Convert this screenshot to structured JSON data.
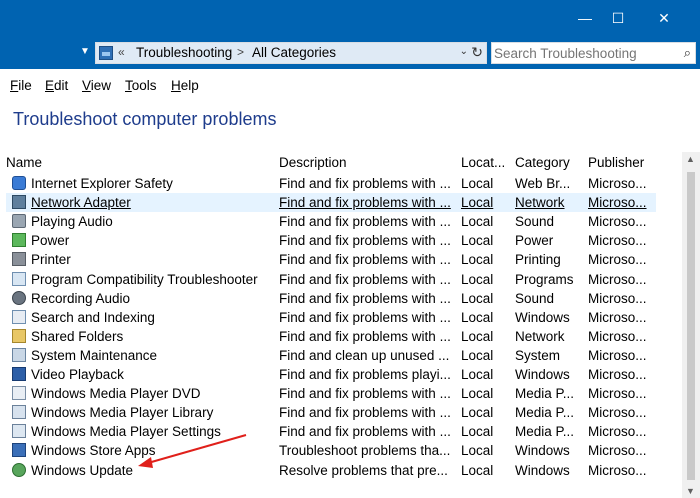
{
  "window": {
    "controls": [
      "—",
      "☐",
      "✕"
    ]
  },
  "address": {
    "overflow": "«",
    "segments": [
      "Troubleshooting",
      "All Categories"
    ],
    "dropdown": "⌄",
    "refresh": "↻"
  },
  "search": {
    "placeholder": "Search Troubleshooting"
  },
  "menu": [
    {
      "first": "F",
      "rest": "ile"
    },
    {
      "first": "E",
      "rest": "dit"
    },
    {
      "first": "V",
      "rest": "iew"
    },
    {
      "first": "T",
      "rest": "ools"
    },
    {
      "first": "H",
      "rest": "elp"
    }
  ],
  "page_title": "Troubleshoot computer problems",
  "columns": [
    "Name",
    "Description",
    "Locat...",
    "Category",
    "Publisher"
  ],
  "rows": [
    {
      "name": "Internet Explorer Safety",
      "desc": "Find and fix problems with ...",
      "loc": "Local",
      "cat": "Web Br...",
      "pub": "Microso...",
      "icon": "internet-explorer-icon"
    },
    {
      "name": "Network Adapter",
      "desc": "Find and fix problems with ...",
      "loc": "Local",
      "cat": "Network",
      "pub": "Microso...",
      "icon": "network-adapter-icon"
    },
    {
      "name": "Playing Audio",
      "desc": "Find and fix problems with ...",
      "loc": "Local",
      "cat": "Sound",
      "pub": "Microso...",
      "icon": "speaker-icon"
    },
    {
      "name": "Power",
      "desc": "Find and fix problems with ...",
      "loc": "Local",
      "cat": "Power",
      "pub": "Microso...",
      "icon": "power-icon"
    },
    {
      "name": "Printer",
      "desc": "Find and fix problems with ...",
      "loc": "Local",
      "cat": "Printing",
      "pub": "Microso...",
      "icon": "printer-icon"
    },
    {
      "name": "Program Compatibility Troubleshooter",
      "desc": "Find and fix problems with ...",
      "loc": "Local",
      "cat": "Programs",
      "pub": "Microso...",
      "icon": "program-compatibility-icon"
    },
    {
      "name": "Recording Audio",
      "desc": "Find and fix problems with ...",
      "loc": "Local",
      "cat": "Sound",
      "pub": "Microso...",
      "icon": "microphone-icon"
    },
    {
      "name": "Search and Indexing",
      "desc": "Find and fix problems with ...",
      "loc": "Local",
      "cat": "Windows",
      "pub": "Microso...",
      "icon": "search-indexing-icon"
    },
    {
      "name": "Shared Folders",
      "desc": "Find and fix problems with ...",
      "loc": "Local",
      "cat": "Network",
      "pub": "Microso...",
      "icon": "shared-folder-icon"
    },
    {
      "name": "System Maintenance",
      "desc": "Find and clean up unused ...",
      "loc": "Local",
      "cat": "System",
      "pub": "Microso...",
      "icon": "system-maintenance-icon"
    },
    {
      "name": "Video Playback",
      "desc": "Find and fix problems playi...",
      "loc": "Local",
      "cat": "Windows",
      "pub": "Microso...",
      "icon": "video-playback-icon"
    },
    {
      "name": "Windows Media Player DVD",
      "desc": "Find and fix problems with ...",
      "loc": "Local",
      "cat": "Media P...",
      "pub": "Microso...",
      "icon": "media-player-dvd-icon"
    },
    {
      "name": "Windows Media Player Library",
      "desc": "Find and fix problems with ...",
      "loc": "Local",
      "cat": "Media P...",
      "pub": "Microso...",
      "icon": "media-player-library-icon"
    },
    {
      "name": "Windows Media Player Settings",
      "desc": "Find and fix problems with ...",
      "loc": "Local",
      "cat": "Media P...",
      "pub": "Microso...",
      "icon": "media-player-settings-icon"
    },
    {
      "name": "Windows Store Apps",
      "desc": "Troubleshoot problems tha...",
      "loc": "Local",
      "cat": "Windows",
      "pub": "Microso...",
      "icon": "store-apps-icon"
    },
    {
      "name": "Windows Update",
      "desc": "Resolve problems that pre...",
      "loc": "Local",
      "cat": "Windows",
      "pub": "Microso...",
      "icon": "windows-update-icon"
    }
  ],
  "colors": {
    "titlebar": "#0063b1",
    "page_title": "#1e3c8c",
    "annotation_arrow": "#e0201b"
  }
}
